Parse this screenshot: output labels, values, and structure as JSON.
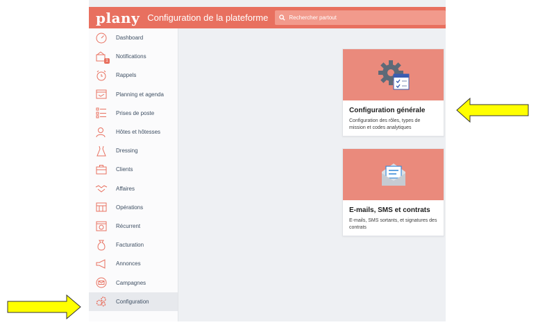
{
  "header": {
    "logo": "plany",
    "title": "Configuration de la plateforme",
    "search_placeholder": "Rechercher partout"
  },
  "sidebar": {
    "items": [
      {
        "label": "Dashboard",
        "icon": "gauge-icon"
      },
      {
        "label": "Notifications",
        "icon": "notifications-icon",
        "badge": "1"
      },
      {
        "label": "Rappels",
        "icon": "alarm-clock-icon"
      },
      {
        "label": "Planning et agenda",
        "icon": "calendar-icon"
      },
      {
        "label": "Prises de poste",
        "icon": "checklist-icon"
      },
      {
        "label": "Hôtes et hôtesses",
        "icon": "users-icon"
      },
      {
        "label": "Dressing",
        "icon": "dress-icon"
      },
      {
        "label": "Clients",
        "icon": "briefcase-icon"
      },
      {
        "label": "Affaires",
        "icon": "handshake-icon"
      },
      {
        "label": "Opérations",
        "icon": "operations-icon"
      },
      {
        "label": "Récurrent",
        "icon": "recurrent-calendar-icon"
      },
      {
        "label": "Facturation",
        "icon": "money-bag-icon"
      },
      {
        "label": "Annonces",
        "icon": "megaphone-icon"
      },
      {
        "label": "Campagnes",
        "icon": "campaign-envelope-icon"
      },
      {
        "label": "Configuration",
        "icon": "gears-icon"
      }
    ],
    "active_index": 14
  },
  "cards": [
    {
      "title": "Configuration générale",
      "description": "Configuration des rôles, types de mission et codes analytiques",
      "icon": "settings-gear-calendar-icon"
    },
    {
      "title": "E-mails, SMS et contrats",
      "description": "E-mails, SMS sortants, et signatures des contrats",
      "icon": "envelope-icon"
    }
  ],
  "annotations": {
    "arrow_color": "#ffff00"
  },
  "colors": {
    "brand": "#e8705f",
    "card_header": "#ea8a7c",
    "sidebar_text": "#3e4f63"
  }
}
